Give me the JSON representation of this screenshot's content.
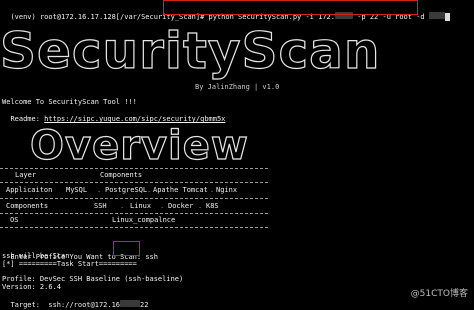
{
  "terminal": {
    "prompt": "(venv) root@172.16.17.128[/var/Security_Scan]",
    "prompt_suffix": "# ",
    "command_start": "python SecurityScan.py -i 172.",
    "command_mid": "-p 22 -u root -d",
    "banner_logo": "SecurityScan",
    "byline": "By JalinZhang | v1.0",
    "welcome": "Welcome To SecurityScan Tool !!!",
    "readme_label": "Readme:",
    "readme_url": "https://sipc.yuque.com/sipc/security/qbmm5x",
    "overview_logo": "Overview",
    "table": {
      "headers": [
        "Layer",
        "Components"
      ],
      "rows": [
        [
          "Applicaiton",
          "MySQL",
          "PostgreSQL",
          "Apathe Tomcat",
          "Nginx"
        ],
        [
          "Components",
          "SSH",
          "Linux",
          "Docker",
          "K8S"
        ],
        [
          "OS",
          "Linux_compalnce"
        ]
      ]
    },
    "input_prompt": "Enter Profile You Want to Scan:",
    "input_value": "ssh",
    "will_scan": "ssh will be Scan",
    "task_start": "[*] =========Task Start=========",
    "profile_line": "Profile: DevSec SSH Baseline (ssh-baseline)",
    "version_line": "Version: 2.6.4",
    "target_prefix": "Target:  ssh://root@172.16",
    "target_suffix": "22"
  },
  "watermark": "@51CTO博客"
}
